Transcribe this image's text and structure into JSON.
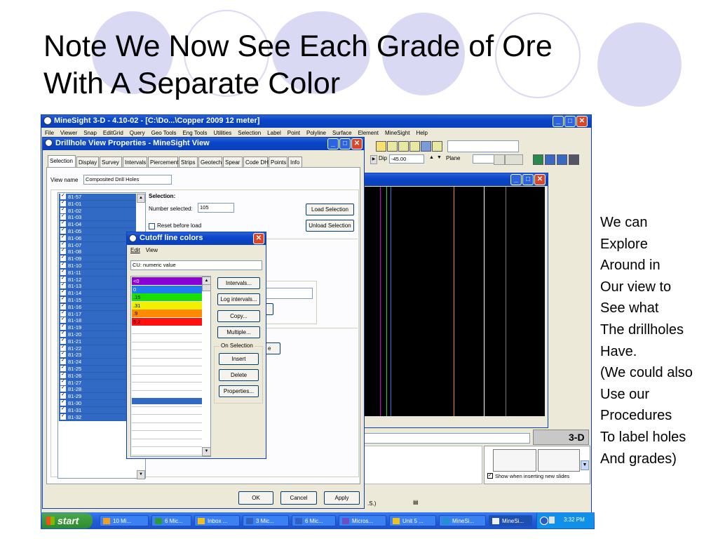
{
  "slide": {
    "title_line1": "Note We Now See Each Grade of Ore",
    "title_line2": "With A Separate Color",
    "side_lines": [
      "We can",
      "Explore",
      "Around in",
      "Our view to",
      "See what",
      "The drillholes",
      "Have.",
      "(We could also",
      "Use our",
      "Procedures",
      "To label holes",
      "And grades)"
    ]
  },
  "main_window": {
    "title": "MineSight 3-D  - 4.10-02 - [C:\\Do...\\Copper 2009 12 meter]",
    "menu": [
      "File",
      "Viewer",
      "Snap",
      "EditGrid",
      "Query",
      "Geo Tools",
      "Eng Tools",
      "Utilities",
      "Selection",
      "Label",
      "Point",
      "Polyline",
      "Surface",
      "Element",
      "MineSight",
      "Help"
    ],
    "dip_label": "Dip",
    "dip_value": "-45.00",
    "plane_label": "Plane",
    "viewer_logo": "3-D"
  },
  "props_window": {
    "title": "Drillhole View Properties - MineSight View",
    "tabs": [
      "Selection",
      "Display",
      "Survey",
      "Intervals",
      "Piercement",
      "Strips",
      "Geotech",
      "Spear",
      "Code DH",
      "Points",
      "Info"
    ],
    "view_name_label": "View name",
    "view_name_value": "Composited Drill Holes",
    "holes": [
      "81-57",
      "81-01",
      "81-02",
      "81-03",
      "81-04",
      "81-05",
      "81-06",
      "81-07",
      "81-08",
      "81-09",
      "81-10",
      "81-11",
      "81-12",
      "81-13",
      "81-14",
      "81-15",
      "81-16",
      "81-17",
      "81-18",
      "81-19",
      "81-20",
      "81-21",
      "81-22",
      "81-23",
      "81-24",
      "81-25",
      "81-26",
      "81-27",
      "81-28",
      "81-29",
      "81-30",
      "81-31",
      "81-32"
    ],
    "selection_heading": "Selection:",
    "number_selected_label": "Number selected:",
    "number_selected_value": "105",
    "load_selection": "Load Selection",
    "unload_selection": "Unload Selection",
    "reset_before_load": "Reset before load",
    "partial_button_text": "e",
    "ok": "OK",
    "cancel": "Cancel",
    "apply": "Apply"
  },
  "cutoff_window": {
    "title": "Cutoff line colors",
    "menu": [
      "Edit",
      "View"
    ],
    "variable": "CU: numeric value",
    "rows": [
      {
        "label": "<0",
        "color": "#8a00d4",
        "text_color": "#ffffff"
      },
      {
        "label": "0",
        "color": "#1e7bf0",
        "text_color": "#ffffff"
      },
      {
        "label": ".15",
        "color": "#19e000",
        "text_color": "#000000"
      },
      {
        "label": ".31",
        "color": "#f0f000",
        "text_color": "#000000"
      },
      {
        "label": ".9",
        "color": "#ff8a00",
        "text_color": "#000000"
      },
      {
        "label": "5.2",
        "color": "#ff1010",
        "text_color": "#000000"
      }
    ],
    "buttons": [
      "Intervals...",
      "Log intervals...",
      "Copy...",
      "Multiple..."
    ],
    "on_selection_label": "On Selection",
    "selection_buttons": [
      "Insert",
      "Delete",
      "Properties..."
    ]
  },
  "ppt_panel": {
    "show_when_inserting": "Show when inserting new slides",
    "status_text": ".S.)"
  },
  "taskbar": {
    "start": "start",
    "items": [
      "10 Mi...",
      "6 Mic...",
      "Inbox ...",
      "3 Mic...",
      "6 Mic...",
      "Micros...",
      "Unit 5 ...",
      "MineSi...",
      "MineSi..."
    ],
    "clock": "3:32 PM"
  }
}
